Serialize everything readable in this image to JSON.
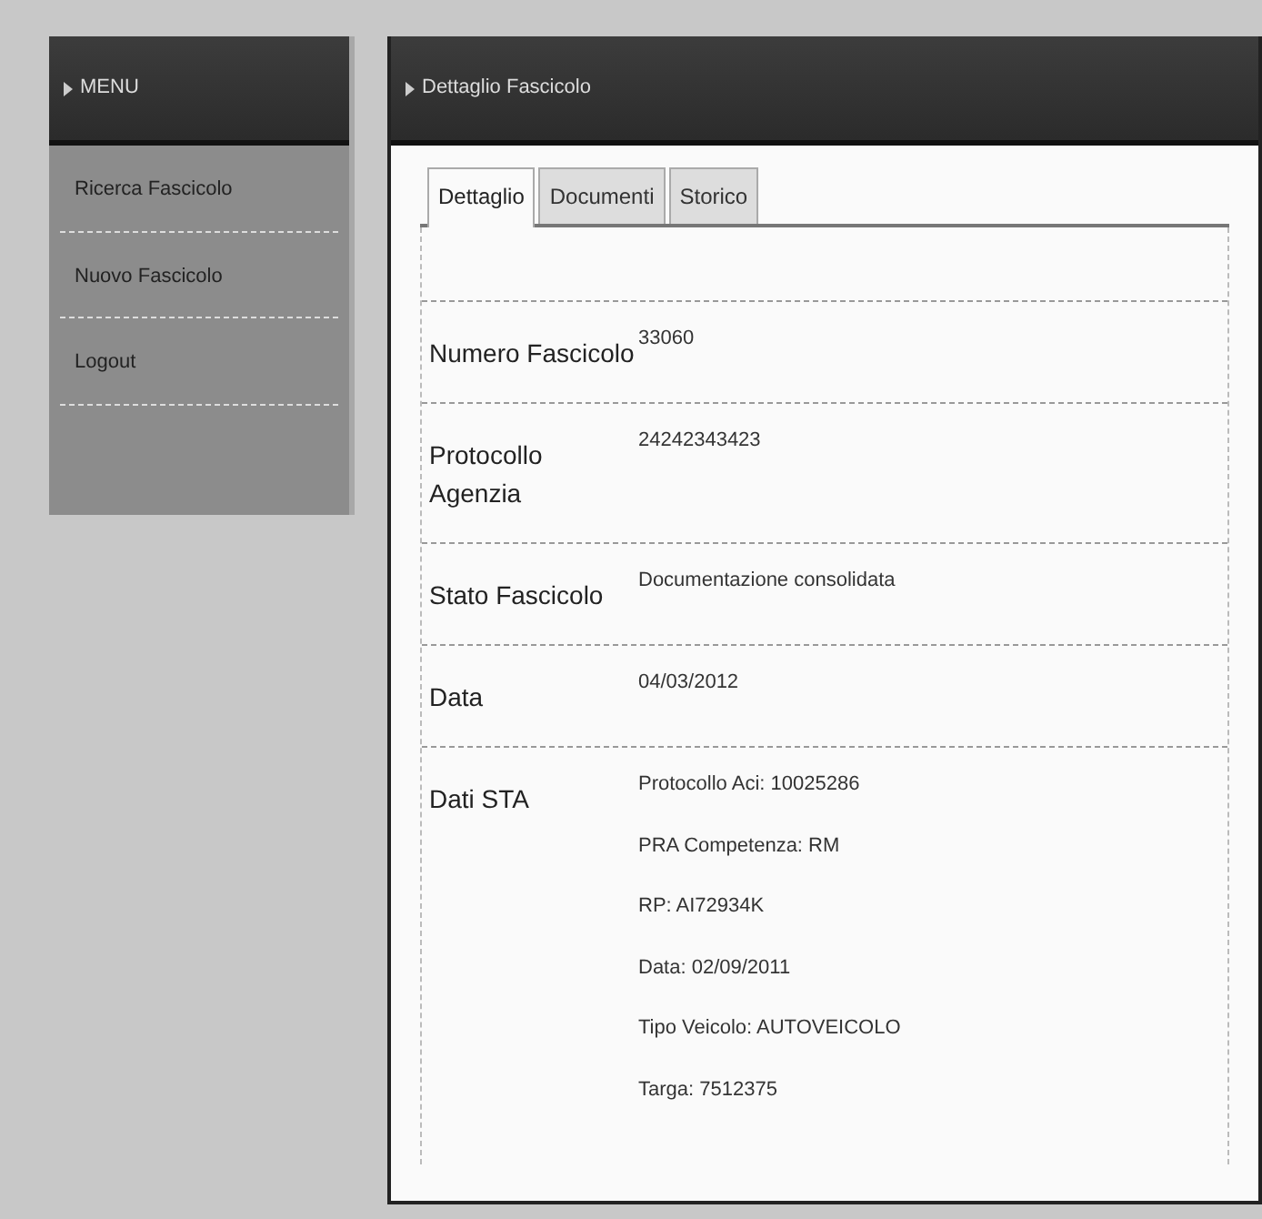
{
  "sidebar": {
    "title": "MENU",
    "items": [
      {
        "label": "Ricerca Fascicolo"
      },
      {
        "label": "Nuovo Fascicolo"
      },
      {
        "label": "Logout"
      }
    ]
  },
  "main": {
    "title": "Dettaglio Fascicolo",
    "tabs": [
      {
        "label": "Dettaglio",
        "selected": true
      },
      {
        "label": "Documenti",
        "selected": false
      },
      {
        "label": "Storico",
        "selected": false
      }
    ],
    "fields": [
      {
        "label": "Numero Fascicolo",
        "values": [
          "33060"
        ]
      },
      {
        "label": "Protocollo Agenzia",
        "values": [
          "24242343423"
        ]
      },
      {
        "label": "Stato Fascicolo",
        "values": [
          "Documentazione consolidata"
        ]
      },
      {
        "label": "Data",
        "values": [
          "04/03/2012"
        ]
      },
      {
        "label": "Dati STA",
        "values": [
          "Protocollo Aci: 10025286",
          "PRA Competenza: RM",
          "RP: AI72934K",
          "Data: 02/09/2011",
          "Tipo Veicolo: AUTOVEICOLO",
          "Targa: 7512375"
        ]
      }
    ]
  }
}
